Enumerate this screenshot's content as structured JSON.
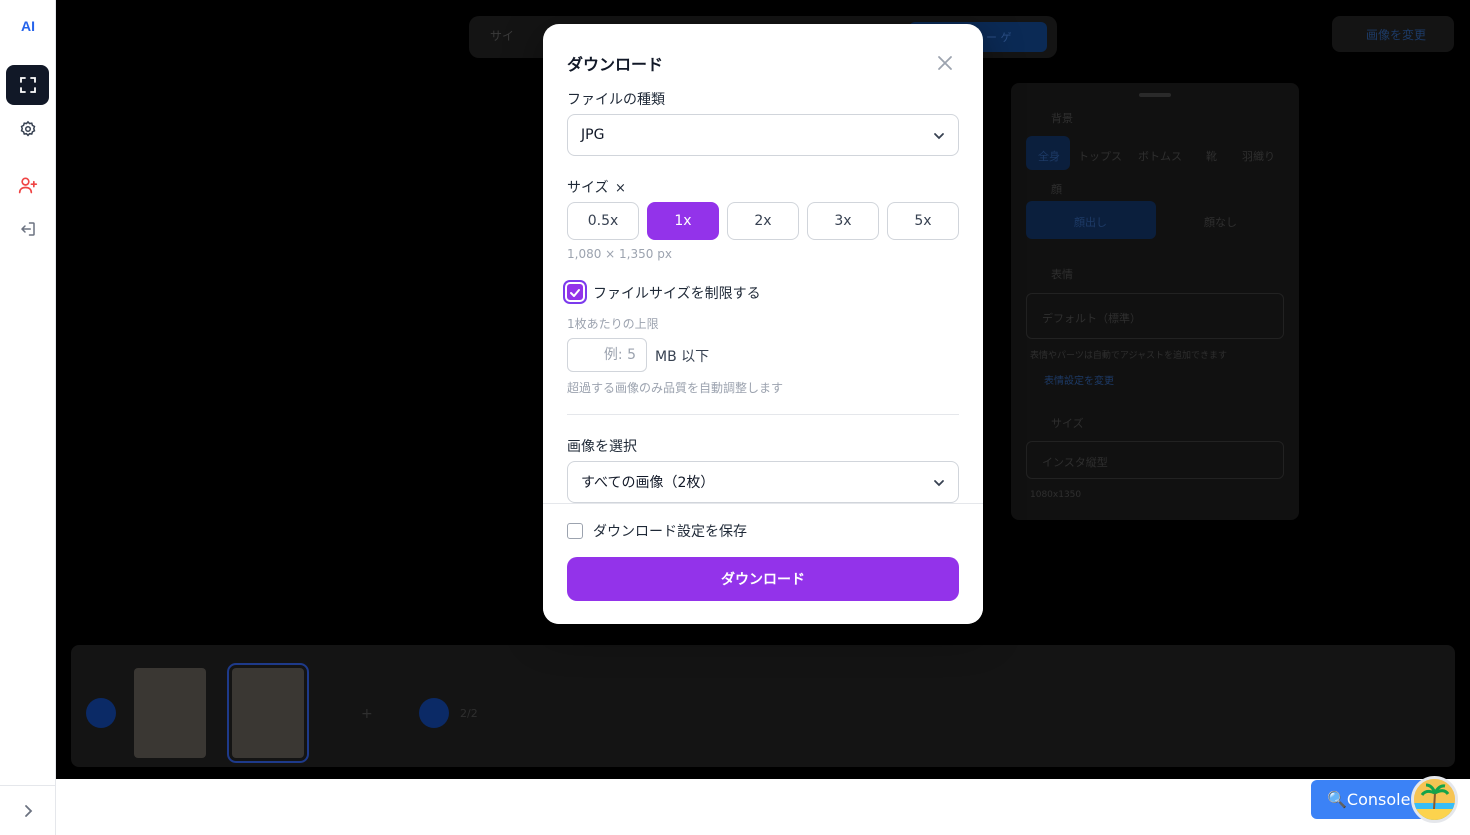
{
  "sidebar": {
    "logo": "AI"
  },
  "background": {
    "topbar_text": "サイ",
    "topbar_highlight_text": "ー ゲ",
    "top_right_button": "画像を変更",
    "panel": {
      "section1": "背景",
      "tabs": [
        "全身",
        "トップス",
        "ボトムス",
        "靴",
        "羽織り"
      ],
      "face_label": "顔",
      "face_options": [
        "顔出し",
        "顔なし"
      ],
      "section2": "表情",
      "select1": "デフォルト（標準）",
      "note1": "表情やパーツは自動でアジャストを追加できます",
      "link1": "表情設定を変更",
      "section3": "サイズ",
      "select2": "インスタ縦型",
      "note2": "1080x1350"
    },
    "strip_counter": "2/2"
  },
  "modal": {
    "title": "ダウンロード",
    "file_type_label": "ファイルの種類",
    "file_type_value": "JPG",
    "size_label": "サイズ",
    "size_options": [
      "0.5x",
      "1x",
      "2x",
      "3x",
      "5x"
    ],
    "size_selected": "1x",
    "dimensions": "1,080 × 1,350 px",
    "limit_label": "ファイルサイズを制限する",
    "limit_checked": true,
    "per_image_label": "1枚あたりの上限",
    "mb_placeholder": "例: 5",
    "mb_unit": "MB 以下",
    "auto_adjust_note": "超過する画像のみ品質を自動調整します",
    "select_image_label": "画像を選択",
    "select_image_value": "すべての画像（2枚）",
    "save_settings_label": "ダウンロード設定を保存",
    "save_settings_checked": false,
    "download_button": "ダウンロード"
  },
  "console": {
    "label": "🔍Console"
  },
  "colors": {
    "accent": "#9333ea",
    "console": "#3b82f6",
    "logo": "#2563eb"
  }
}
